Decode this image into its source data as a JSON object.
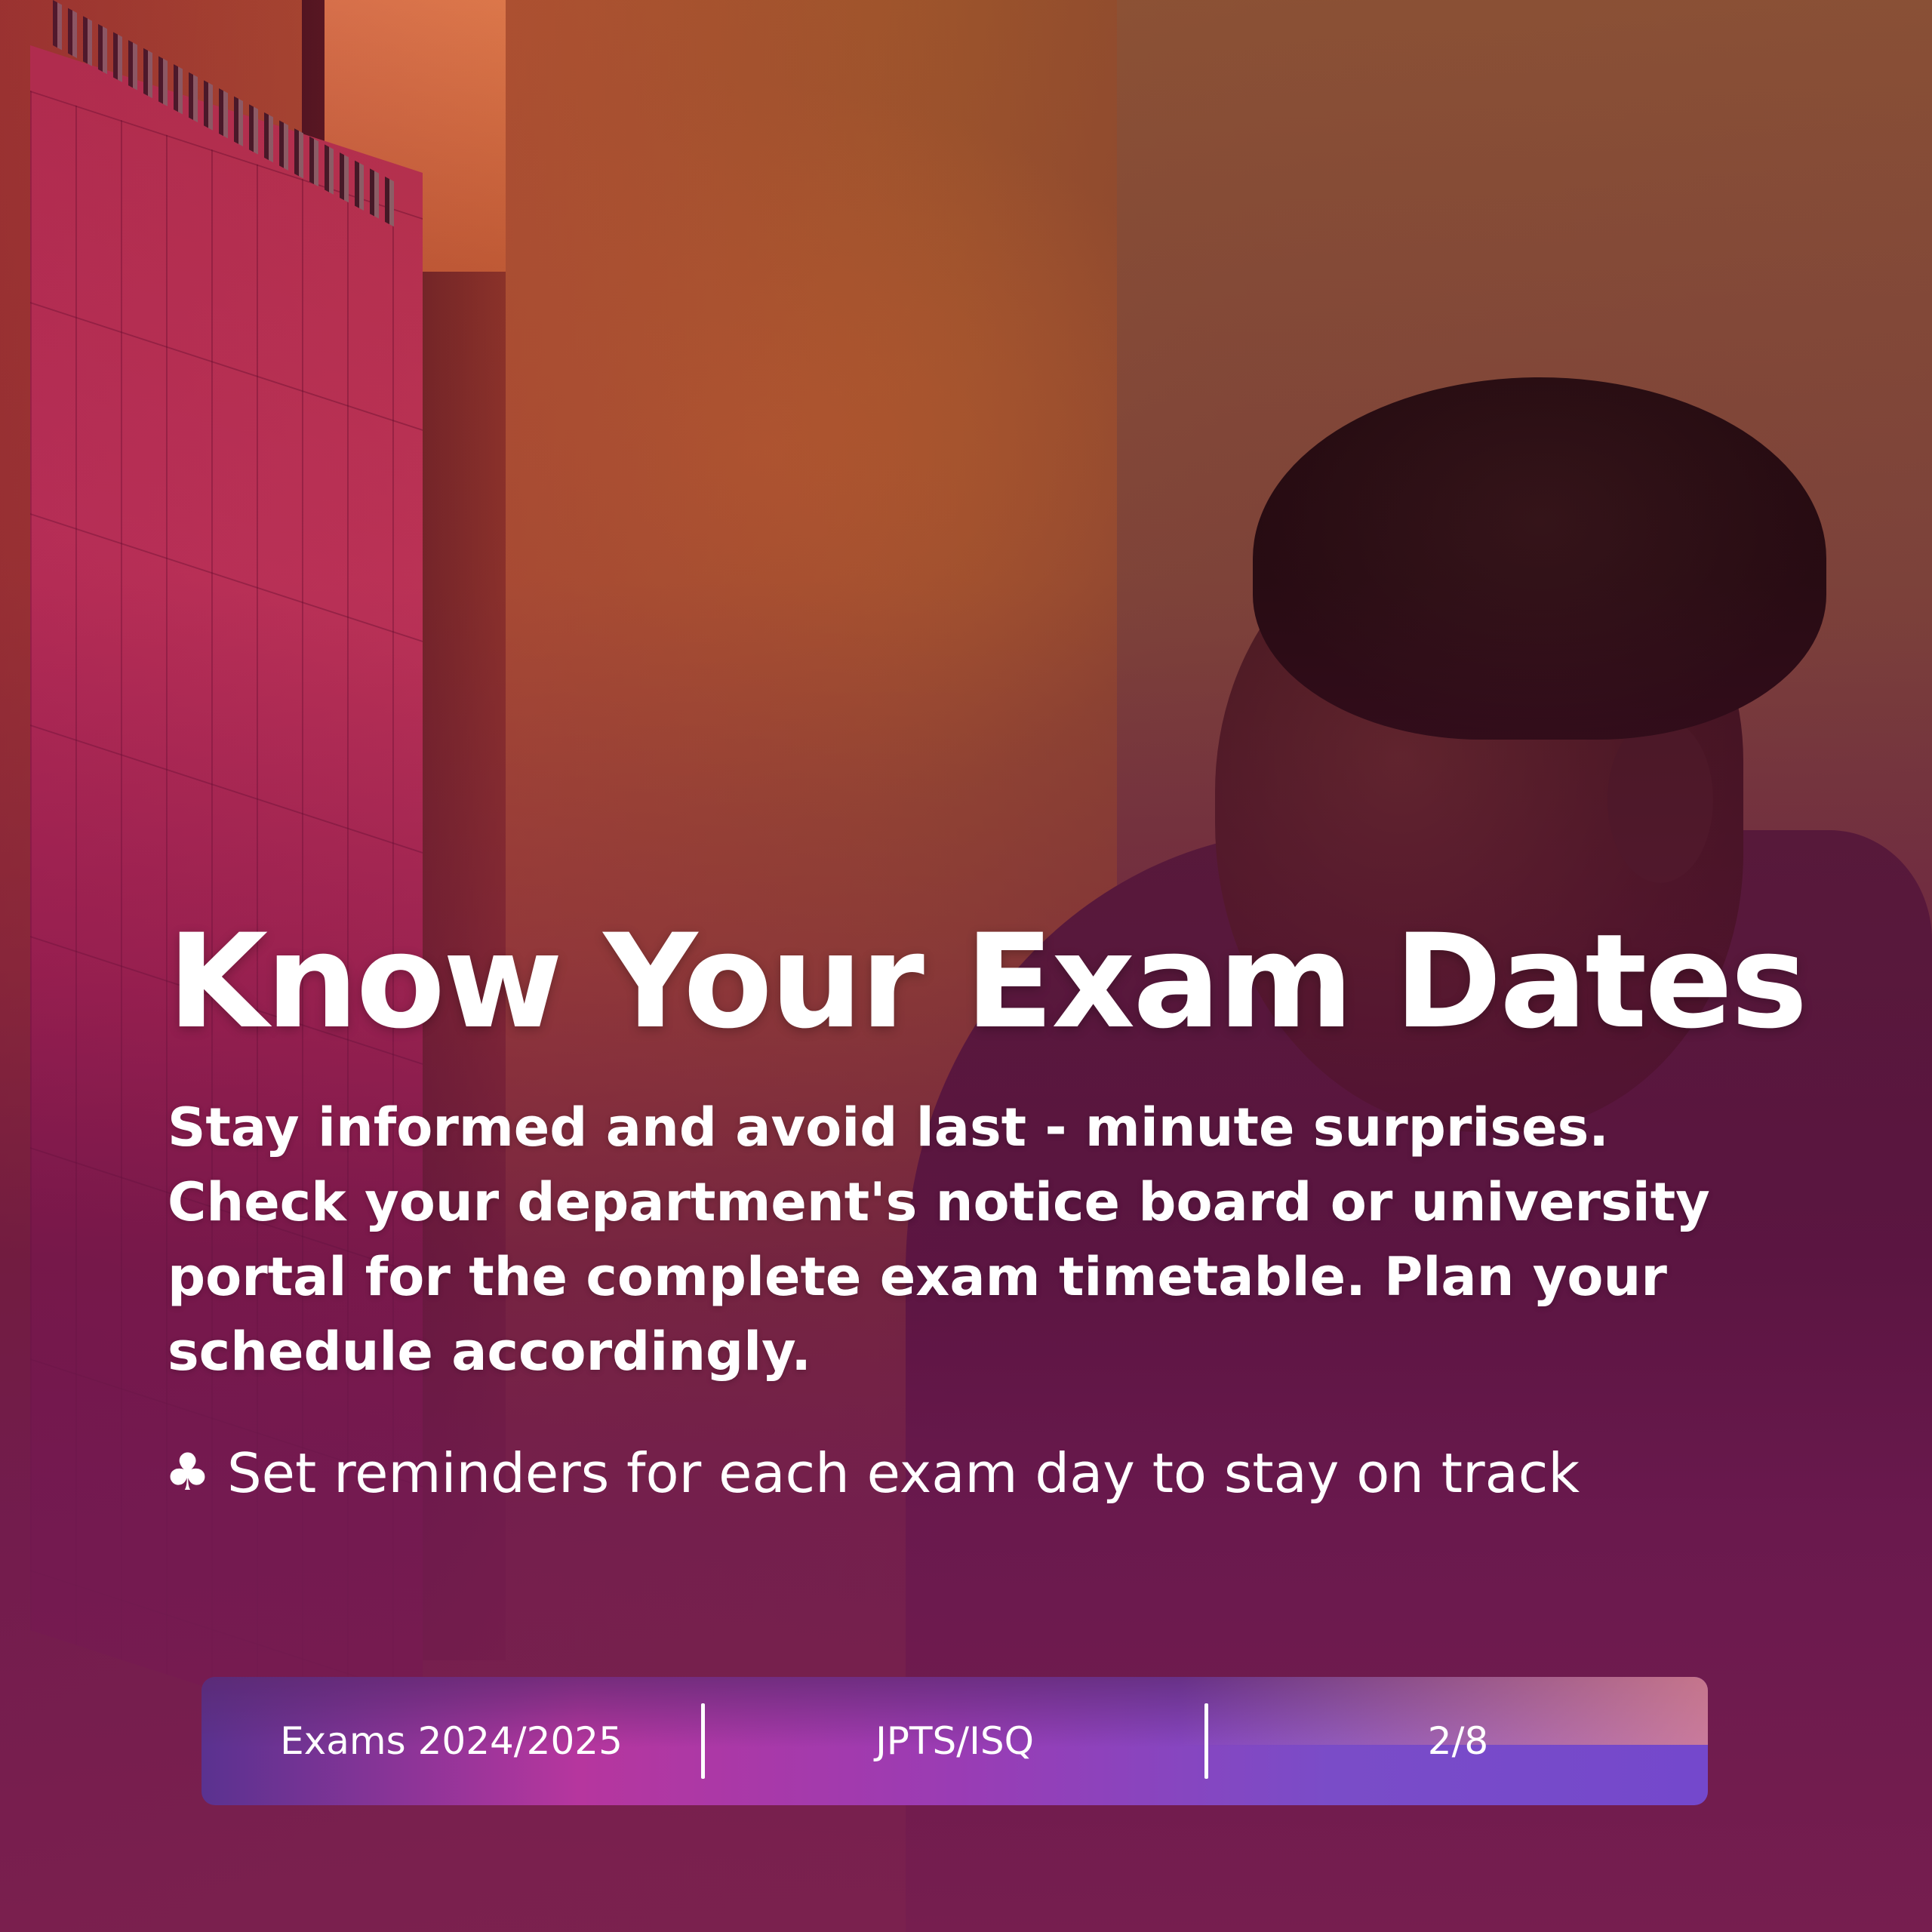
{
  "slide": {
    "title": "Know Your Exam Dates",
    "body": "Stay informed and avoid last - minute surprises. Check your department's notice board or university portal for the complete exam timetable. Plan your schedule accordingly.",
    "tip": {
      "icon": "club-icon",
      "glyph": "♣",
      "text": "Set reminders for each exam day to stay on track"
    }
  },
  "footer": {
    "session": "Exams 2024/2025",
    "handle": "JPTS/ISQ",
    "page": "2/8"
  },
  "colors": {
    "overlay": "#6b1a4a",
    "text": "#ffffff",
    "bar_start": "#b6369e",
    "bar_end": "#7448cc"
  }
}
